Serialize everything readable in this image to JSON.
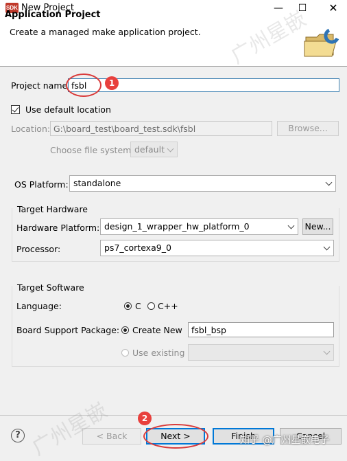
{
  "window": {
    "app_icon_text": "SDK",
    "title": "New Project",
    "minimize_icon": "minimize-icon",
    "maximize_icon": "maximize-icon",
    "close_icon": "close-icon"
  },
  "banner": {
    "title": "Application Project",
    "subtitle": "Create a managed make application project.",
    "icon": "folder-c-icon"
  },
  "project": {
    "name_label": "Project name:",
    "name_value": "fsbl",
    "use_default_label": "Use default location",
    "use_default_checked": true,
    "location_label": "Location:",
    "location_value": "G:\\board_test\\board_test.sdk\\fsbl",
    "browse_label": "Browse...",
    "fs_label": "Choose file system:",
    "fs_value": "default"
  },
  "os": {
    "label": "OS Platform:",
    "value": "standalone"
  },
  "hardware": {
    "group_title": "Target Hardware",
    "platform_label": "Hardware Platform:",
    "platform_value": "design_1_wrapper_hw_platform_0",
    "new_label": "New...",
    "processor_label": "Processor:",
    "processor_value": "ps7_cortexa9_0"
  },
  "software": {
    "group_title": "Target Software",
    "language_label": "Language:",
    "lang_c": "C",
    "lang_cpp": "C++",
    "selected_language": "C",
    "bsp_label": "Board Support Package:",
    "create_new_label": "Create New",
    "bsp_value": "fsbl_bsp",
    "use_existing_label": "Use existing"
  },
  "footer": {
    "help_icon": "help-icon",
    "back_label": "< Back",
    "next_label": "Next >",
    "finish_label": "Finish",
    "cancel_label": "Cancel"
  },
  "annotations": {
    "badge_1": "1",
    "badge_2": "2"
  },
  "watermark": {
    "text": "广州星嵌",
    "footer_text": "知乎 @广州星嵌电子"
  },
  "colors": {
    "annotation_red": "#d93b3b",
    "focus_blue": "#0078d7"
  }
}
